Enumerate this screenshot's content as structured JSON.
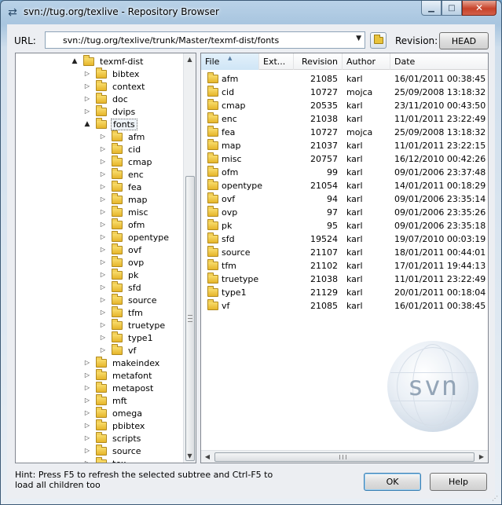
{
  "window": {
    "title": "svn://tug.org/texlive - Repository Browser",
    "minimize_glyph": "▁",
    "maximize_glyph": "□",
    "close_glyph": "✕"
  },
  "toolbar": {
    "url_label": "URL:",
    "url_value": "svn://tug.org/texlive/trunk/Master/texmf-dist/fonts",
    "revision_label": "Revision:",
    "revision_value": "HEAD"
  },
  "tree": {
    "items": [
      {
        "label": "texmf-dist",
        "level": 0,
        "expander": "open"
      },
      {
        "label": "bibtex",
        "level": 1,
        "expander": "closed"
      },
      {
        "label": "context",
        "level": 1,
        "expander": "closed"
      },
      {
        "label": "doc",
        "level": 1,
        "expander": "closed"
      },
      {
        "label": "dvips",
        "level": 1,
        "expander": "closed"
      },
      {
        "label": "fonts",
        "level": 1,
        "expander": "open",
        "selected": true
      },
      {
        "label": "afm",
        "level": 2,
        "expander": "closed"
      },
      {
        "label": "cid",
        "level": 2,
        "expander": "closed"
      },
      {
        "label": "cmap",
        "level": 2,
        "expander": "closed"
      },
      {
        "label": "enc",
        "level": 2,
        "expander": "closed"
      },
      {
        "label": "fea",
        "level": 2,
        "expander": "closed"
      },
      {
        "label": "map",
        "level": 2,
        "expander": "closed"
      },
      {
        "label": "misc",
        "level": 2,
        "expander": "closed"
      },
      {
        "label": "ofm",
        "level": 2,
        "expander": "closed"
      },
      {
        "label": "opentype",
        "level": 2,
        "expander": "closed"
      },
      {
        "label": "ovf",
        "level": 2,
        "expander": "closed"
      },
      {
        "label": "ovp",
        "level": 2,
        "expander": "closed"
      },
      {
        "label": "pk",
        "level": 2,
        "expander": "closed"
      },
      {
        "label": "sfd",
        "level": 2,
        "expander": "closed"
      },
      {
        "label": "source",
        "level": 2,
        "expander": "closed"
      },
      {
        "label": "tfm",
        "level": 2,
        "expander": "closed"
      },
      {
        "label": "truetype",
        "level": 2,
        "expander": "closed"
      },
      {
        "label": "type1",
        "level": 2,
        "expander": "closed"
      },
      {
        "label": "vf",
        "level": 2,
        "expander": "closed"
      },
      {
        "label": "makeindex",
        "level": 1,
        "expander": "closed"
      },
      {
        "label": "metafont",
        "level": 1,
        "expander": "closed"
      },
      {
        "label": "metapost",
        "level": 1,
        "expander": "closed"
      },
      {
        "label": "mft",
        "level": 1,
        "expander": "closed"
      },
      {
        "label": "omega",
        "level": 1,
        "expander": "closed"
      },
      {
        "label": "pbibtex",
        "level": 1,
        "expander": "closed"
      },
      {
        "label": "scripts",
        "level": 1,
        "expander": "closed"
      },
      {
        "label": "source",
        "level": 1,
        "expander": "closed"
      },
      {
        "label": "tex",
        "level": 1,
        "expander": "closed"
      }
    ]
  },
  "list": {
    "columns": [
      "File",
      "Ext...",
      "Revision",
      "Author",
      "Date"
    ],
    "rows": [
      {
        "name": "afm",
        "ext": "",
        "revision": "21085",
        "author": "karl",
        "date": "16/01/2011 00:38:45"
      },
      {
        "name": "cid",
        "ext": "",
        "revision": "10727",
        "author": "mojca",
        "date": "25/09/2008 13:18:32"
      },
      {
        "name": "cmap",
        "ext": "",
        "revision": "20535",
        "author": "karl",
        "date": "23/11/2010 00:43:50"
      },
      {
        "name": "enc",
        "ext": "",
        "revision": "21038",
        "author": "karl",
        "date": "11/01/2011 23:22:49"
      },
      {
        "name": "fea",
        "ext": "",
        "revision": "10727",
        "author": "mojca",
        "date": "25/09/2008 13:18:32"
      },
      {
        "name": "map",
        "ext": "",
        "revision": "21037",
        "author": "karl",
        "date": "11/01/2011 23:22:15"
      },
      {
        "name": "misc",
        "ext": "",
        "revision": "20757",
        "author": "karl",
        "date": "16/12/2010 00:42:26"
      },
      {
        "name": "ofm",
        "ext": "",
        "revision": "99",
        "author": "karl",
        "date": "09/01/2006 23:37:48"
      },
      {
        "name": "opentype",
        "ext": "",
        "revision": "21054",
        "author": "karl",
        "date": "14/01/2011 00:18:29"
      },
      {
        "name": "ovf",
        "ext": "",
        "revision": "94",
        "author": "karl",
        "date": "09/01/2006 23:35:14"
      },
      {
        "name": "ovp",
        "ext": "",
        "revision": "97",
        "author": "karl",
        "date": "09/01/2006 23:35:26"
      },
      {
        "name": "pk",
        "ext": "",
        "revision": "95",
        "author": "karl",
        "date": "09/01/2006 23:35:18"
      },
      {
        "name": "sfd",
        "ext": "",
        "revision": "19524",
        "author": "karl",
        "date": "19/07/2010 00:03:19"
      },
      {
        "name": "source",
        "ext": "",
        "revision": "21107",
        "author": "karl",
        "date": "18/01/2011 00:44:01"
      },
      {
        "name": "tfm",
        "ext": "",
        "revision": "21102",
        "author": "karl",
        "date": "17/01/2011 19:44:13"
      },
      {
        "name": "truetype",
        "ext": "",
        "revision": "21038",
        "author": "karl",
        "date": "11/01/2011 23:22:49"
      },
      {
        "name": "type1",
        "ext": "",
        "revision": "21129",
        "author": "karl",
        "date": "20/01/2011 00:18:04"
      },
      {
        "name": "vf",
        "ext": "",
        "revision": "21085",
        "author": "karl",
        "date": "16/01/2011 00:38:45"
      }
    ],
    "watermark": "svn"
  },
  "footer": {
    "hint": "Hint: Press F5 to refresh the selected subtree and Ctrl-F5 to load all children too",
    "ok_label": "OK",
    "help_label": "Help"
  },
  "icons": {
    "app": "repo-browser-icon",
    "folder": "folder-icon",
    "tree_open": "▲",
    "tree_closed": "▷"
  }
}
